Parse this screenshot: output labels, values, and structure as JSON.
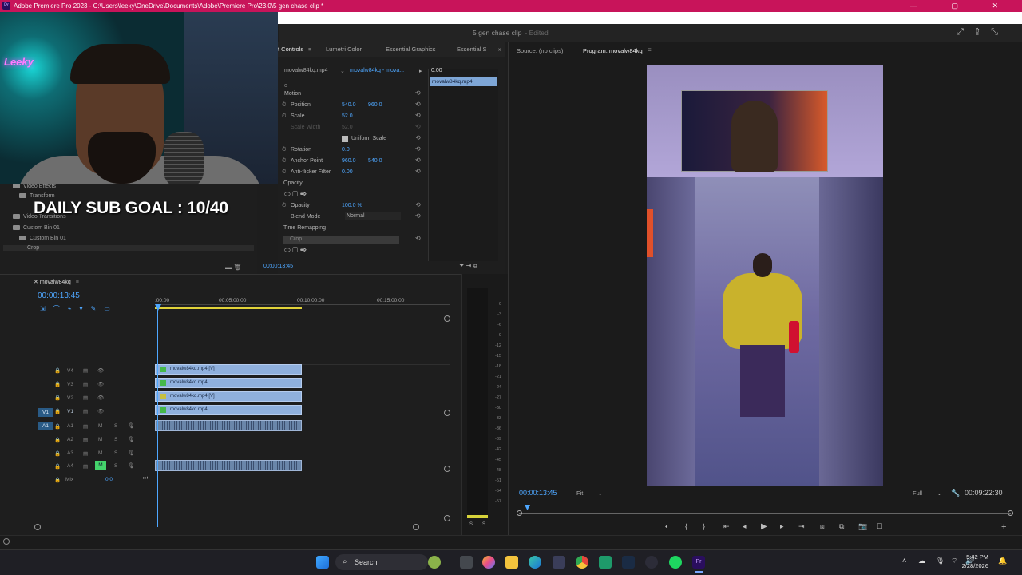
{
  "window": {
    "title": "Adobe Premiere Pro 2023 - C:\\Users\\leeky\\OneDrive\\Documents\\Adobe\\Premiere Pro\\23.0\\5 gen chase clip *",
    "project_name": "5 gen chase clip",
    "edited_status": "- Edited"
  },
  "overlay": {
    "goal_text": "DAILY SUB GOAL : 10/40",
    "neon_sign": "Leeky"
  },
  "project_panel": {
    "items": [
      "Video Effects",
      "Transform",
      "Video Transitions",
      "Custom Bin 01",
      "Custom Bin 01",
      "Crop"
    ]
  },
  "effect_controls": {
    "tabs": [
      "t Controls",
      "Lumetri Color",
      "Essential Graphics",
      "Essential S"
    ],
    "source_clip": "movalw84kq.mp4",
    "sequence_clip": "movalw84kq - mova...",
    "time_start": "0:00",
    "clip_bar": "movalw84kq.mp4",
    "motion_label": "Motion",
    "position_label": "Position",
    "position_x": "540.0",
    "position_y": "960.0",
    "scale_label": "Scale",
    "scale_value": "52.0",
    "scale_width_label": "Scale Width",
    "scale_width_value": "52.0",
    "uniform_scale": "Uniform Scale",
    "rotation_label": "Rotation",
    "rotation_value": "0.0",
    "anchor_label": "Anchor Point",
    "anchor_x": "960.0",
    "anchor_y": "540.0",
    "antiflicker_label": "Anti-flicker Filter",
    "antiflicker_value": "0.00",
    "opacity_group": "Opacity",
    "opacity_label": "Opacity",
    "opacity_value": "100.0 %",
    "blend_label": "Blend Mode",
    "blend_value": "Normal",
    "time_remap": "Time Remapping",
    "crop_label": "Crop",
    "timecode": "00:00:13:45"
  },
  "sequence": {
    "tab": "movalw84kq",
    "timecode": "00:00:13:45",
    "ruler": [
      ":00:00",
      "00:05:00:00",
      "00:10:00:00",
      "00:15:00:00"
    ],
    "video_tracks": [
      {
        "name": "V4",
        "clip": "movalw84kq.mp4 [V]"
      },
      {
        "name": "V3",
        "clip": "movalw84kq.mp4"
      },
      {
        "name": "V2",
        "clip": "movalw84kq.mp4 [V]"
      },
      {
        "name": "V1",
        "clip": "movalw84kq.mp4"
      }
    ],
    "audio_tracks": [
      "A1",
      "A2",
      "A3",
      "A4"
    ],
    "mix_label": "Mix",
    "mix_value": "0.0",
    "track_src_v": "V1",
    "track_src_a": "A1",
    "m_label": "M",
    "s_label": "S"
  },
  "meter": {
    "db": [
      "0",
      "-3",
      "-6",
      "-9",
      "-12",
      "-15",
      "-18",
      "-21",
      "-24",
      "-27",
      "-30",
      "-33",
      "-36",
      "-39",
      "-42",
      "-45",
      "-48",
      "-51",
      "-54",
      "-57"
    ],
    "s_left": "S",
    "s_right": "S"
  },
  "program": {
    "source_tab": "Source: (no clips)",
    "program_tab": "Program: movalw84kq",
    "timecode": "00:00:13:45",
    "fit": "Fit",
    "full": "Full",
    "duration": "00:09:22:30"
  },
  "taskbar": {
    "search": "Search",
    "time": "5:42 PM",
    "date": "2/28/2026"
  },
  "colors": {
    "titlebar": "#c8145a",
    "accent": "#4ea7ff",
    "clip_video": "#8fb0dd"
  }
}
